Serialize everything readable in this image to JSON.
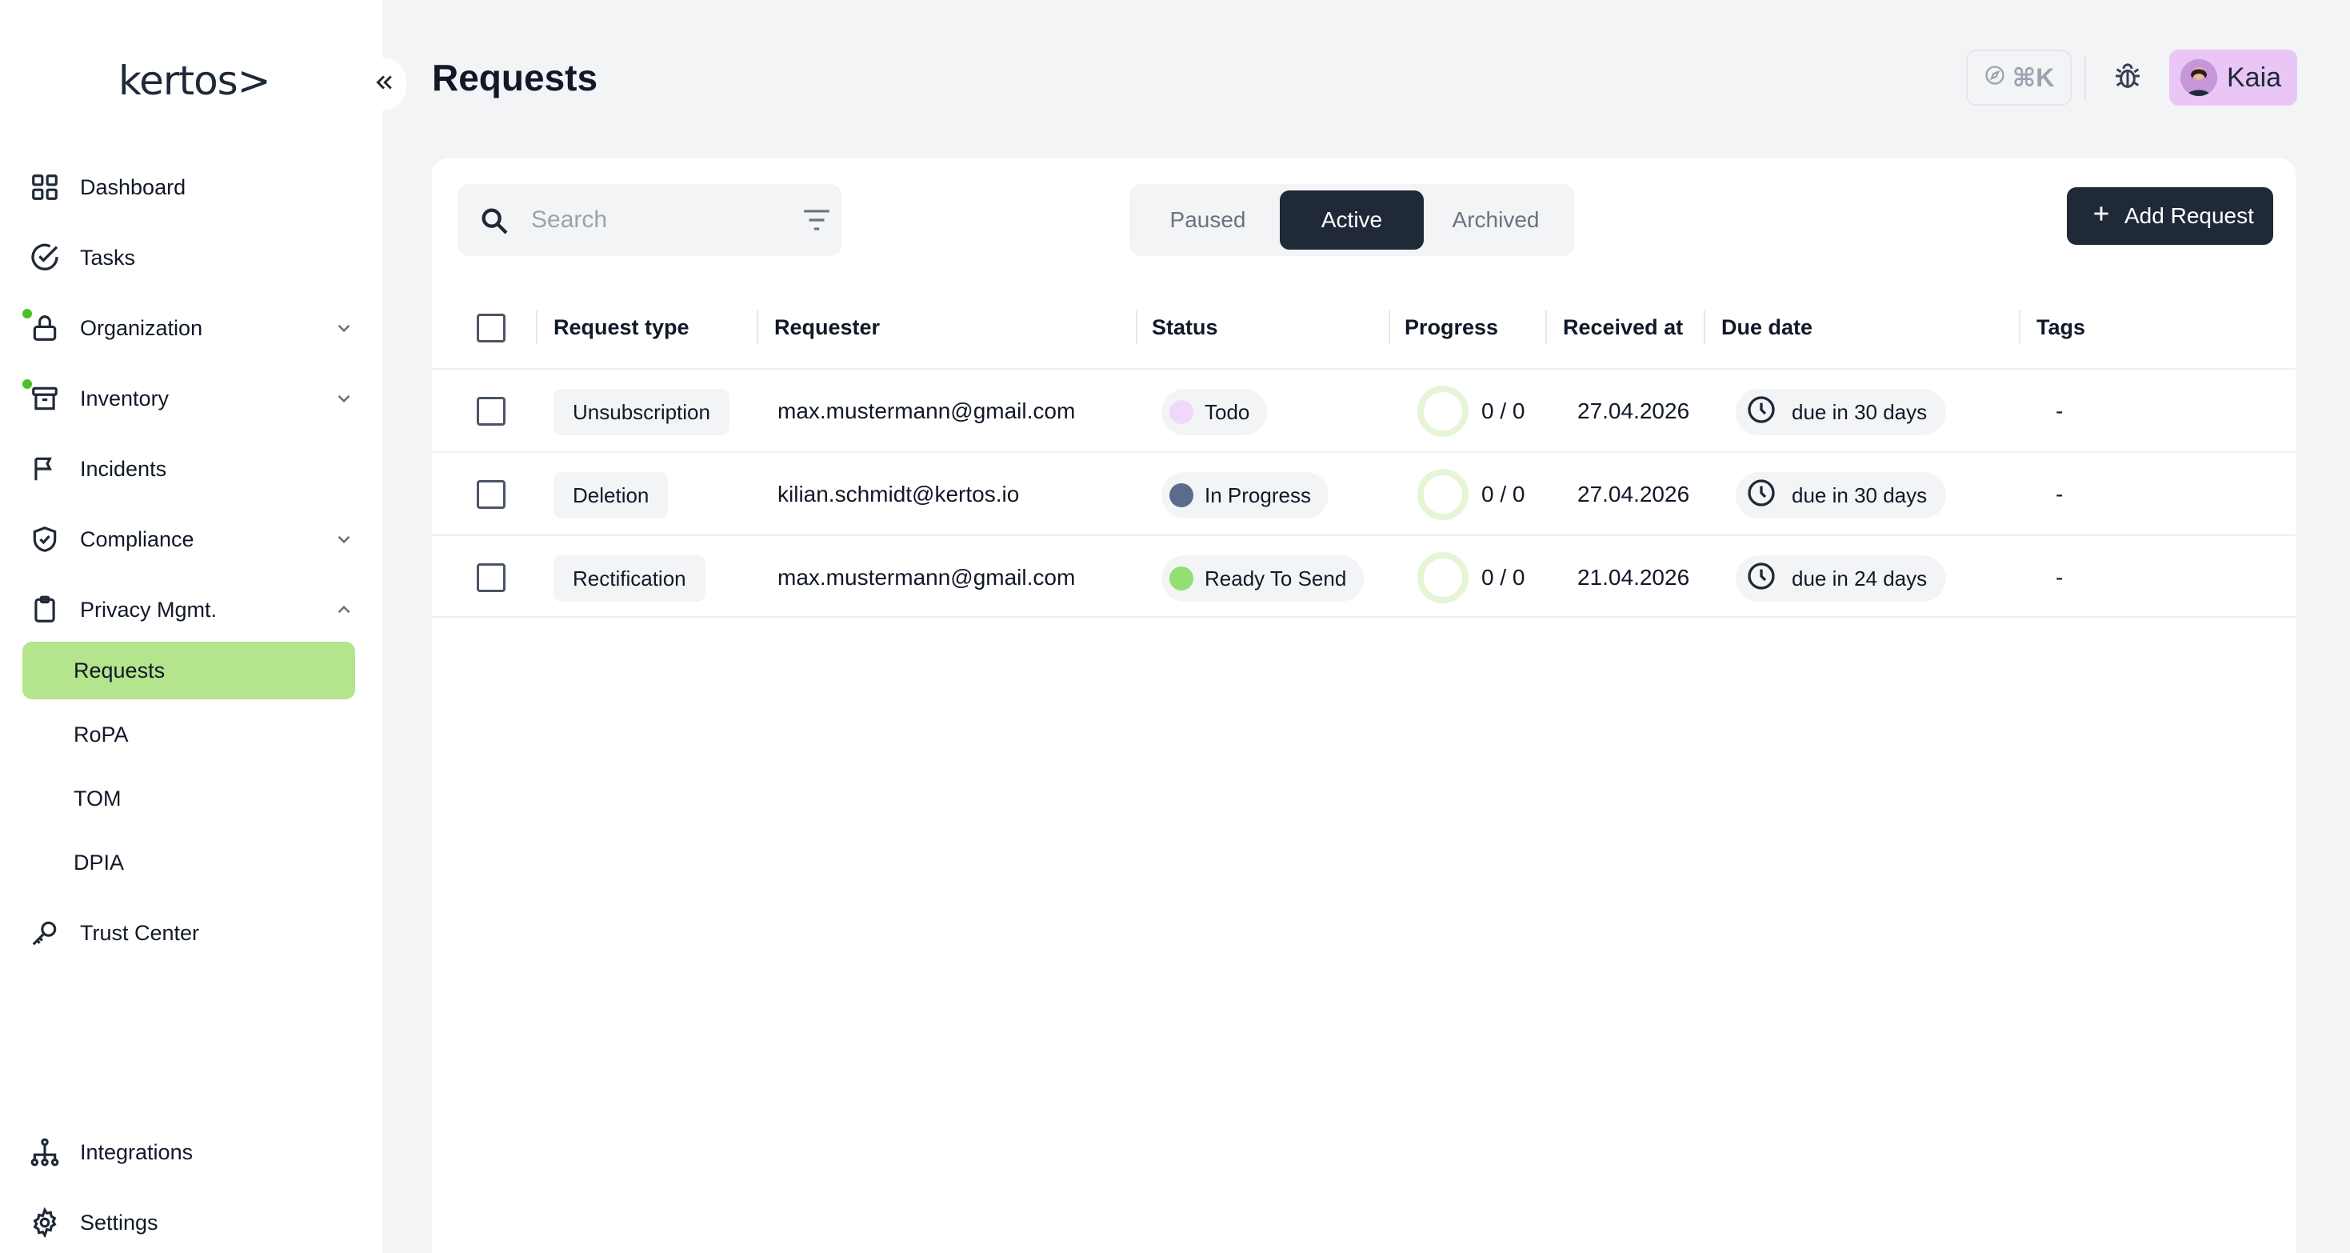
{
  "sidebar": {
    "logo": "kertos>",
    "items": [
      {
        "label": "Dashboard",
        "icon": "grid-icon"
      },
      {
        "label": "Tasks",
        "icon": "check-circle-icon"
      },
      {
        "label": "Organization",
        "icon": "lock-icon",
        "expandable": true,
        "dot": true
      },
      {
        "label": "Inventory",
        "icon": "archive-icon",
        "expandable": true,
        "dot": true
      },
      {
        "label": "Incidents",
        "icon": "flag-icon"
      },
      {
        "label": "Compliance",
        "icon": "shield-check-icon",
        "expandable": true
      },
      {
        "label": "Privacy Mgmt.",
        "icon": "clipboard-icon",
        "expanded": true
      }
    ],
    "sub_items": [
      "Requests",
      "RoPA",
      "TOM",
      "DPIA"
    ],
    "active_sub": "Requests",
    "trust_center": "Trust Center",
    "integrations": "Integrations",
    "settings": "Settings"
  },
  "header": {
    "title": "Requests",
    "shortcut": "⌘K",
    "user_name": "Kaia"
  },
  "toolbar": {
    "search_placeholder": "Search",
    "tabs": [
      "Paused",
      "Active",
      "Archived"
    ],
    "active_tab": "Active",
    "add_label": "Add Request"
  },
  "table": {
    "columns": [
      "Request type",
      "Requester",
      "Status",
      "Progress",
      "Received at",
      "Due date",
      "Tags"
    ],
    "rows": [
      {
        "type": "Unsubscription",
        "requester": "max.mustermann@gmail.com",
        "status": "Todo",
        "status_color": "#f0d8fb",
        "progress": "0 / 0",
        "received": "27.04.2026",
        "due": "due in 30 days",
        "tags": "-"
      },
      {
        "type": "Deletion",
        "requester": "kilian.schmidt@kertos.io",
        "status": "In Progress",
        "status_color": "#5c6a8c",
        "progress": "0 / 0",
        "received": "27.04.2026",
        "due": "due in 30 days",
        "tags": "-"
      },
      {
        "type": "Rectification",
        "requester": "max.mustermann@gmail.com",
        "status": "Ready To Send",
        "status_color": "#93df72",
        "progress": "0 / 0",
        "received": "21.04.2026",
        "due": "due in 24 days",
        "tags": "-"
      }
    ]
  },
  "colors": {
    "accent": "#b4e48c",
    "dark": "#1f2937",
    "notification_dot": "#4ac126"
  }
}
